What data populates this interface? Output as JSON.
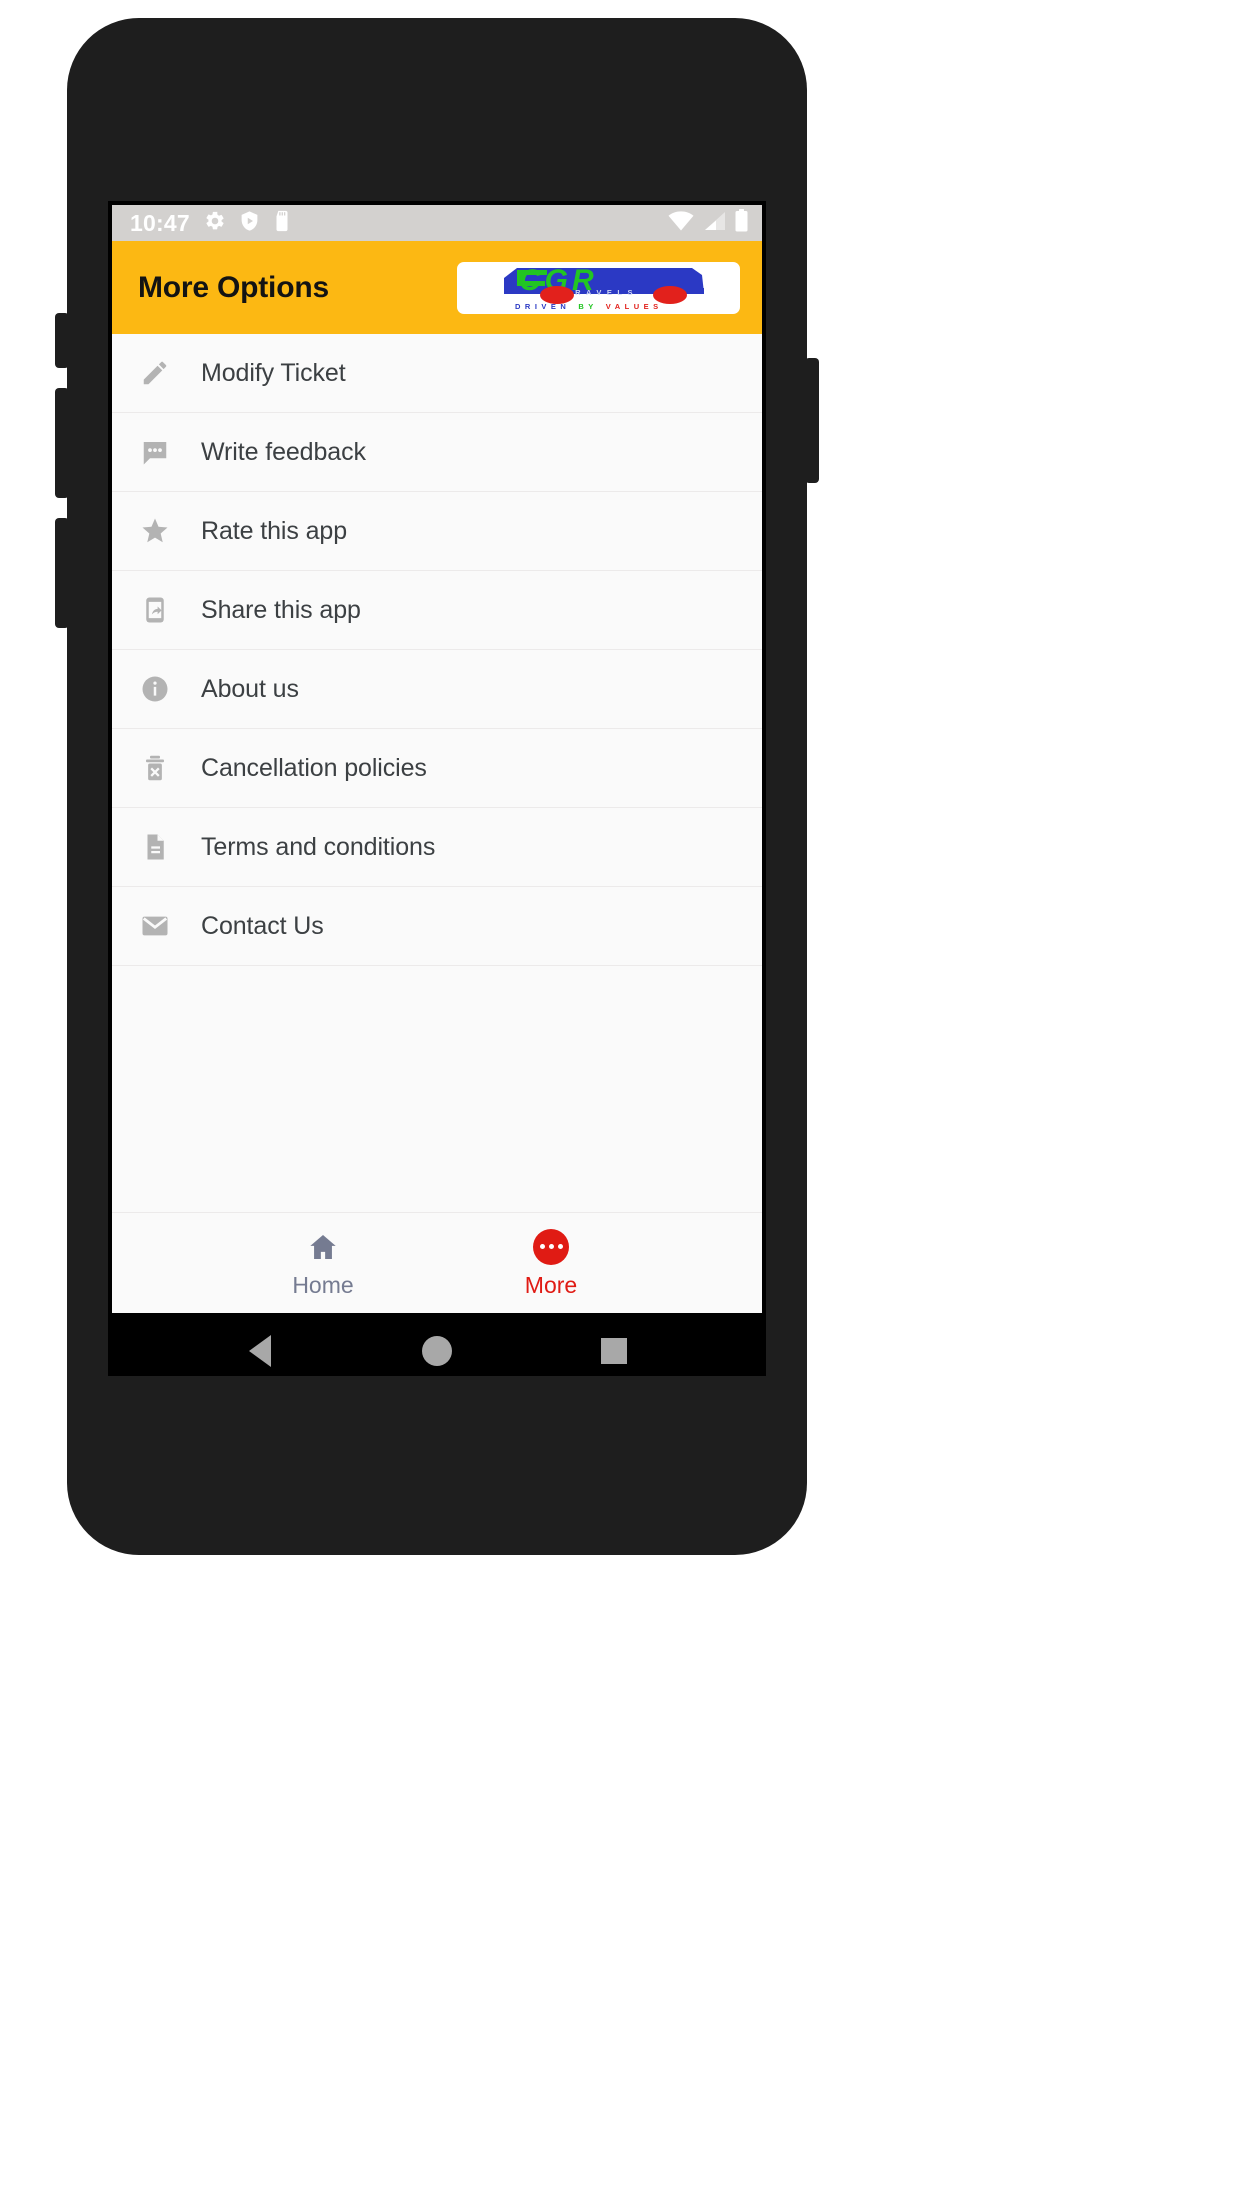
{
  "status_bar": {
    "time": "10:47",
    "left_icons": [
      "gear-icon",
      "play-protect-shield-icon",
      "sd-card-icon"
    ],
    "right_icons": [
      "wifi-icon",
      "cellular-signal-icon",
      "battery-icon"
    ],
    "background_color": "#d3d1cf"
  },
  "app_bar": {
    "title": "More Options",
    "background_color": "#fcb813",
    "title_color": "#131313",
    "logo": {
      "brand": "CGR",
      "sub_text": "TRAVELS",
      "tagline": "DRIVEN BY VALUES",
      "brand_color": "#22c522",
      "bus_color": "#2b39c4",
      "wheel_color": "#e2211c"
    }
  },
  "menu": {
    "items": [
      {
        "label": "Modify Ticket",
        "icon": "pencil-icon"
      },
      {
        "label": "Write feedback",
        "icon": "comment-dots-icon"
      },
      {
        "label": "Rate this app",
        "icon": "star-icon"
      },
      {
        "label": "Share this app",
        "icon": "share-phone-icon"
      },
      {
        "label": "About us",
        "icon": "info-circle-icon"
      },
      {
        "label": "Cancellation policies",
        "icon": "trash-x-icon"
      },
      {
        "label": "Terms and conditions",
        "icon": "document-icon"
      },
      {
        "label": "Contact Us",
        "icon": "envelope-icon"
      }
    ],
    "icon_color": "#b3b3b3",
    "text_color": "#3c4043"
  },
  "tab_bar": {
    "tabs": [
      {
        "label": "Home",
        "icon": "home-icon",
        "active": false,
        "color": "#757b91"
      },
      {
        "label": "More",
        "icon": "more-dots-icon",
        "active": true,
        "color": "#e01b14"
      }
    ]
  },
  "nav_bar": {
    "buttons": [
      "back-icon",
      "home-icon",
      "recents-icon"
    ],
    "color": "#a8a8a8",
    "background_color": "#000000"
  }
}
